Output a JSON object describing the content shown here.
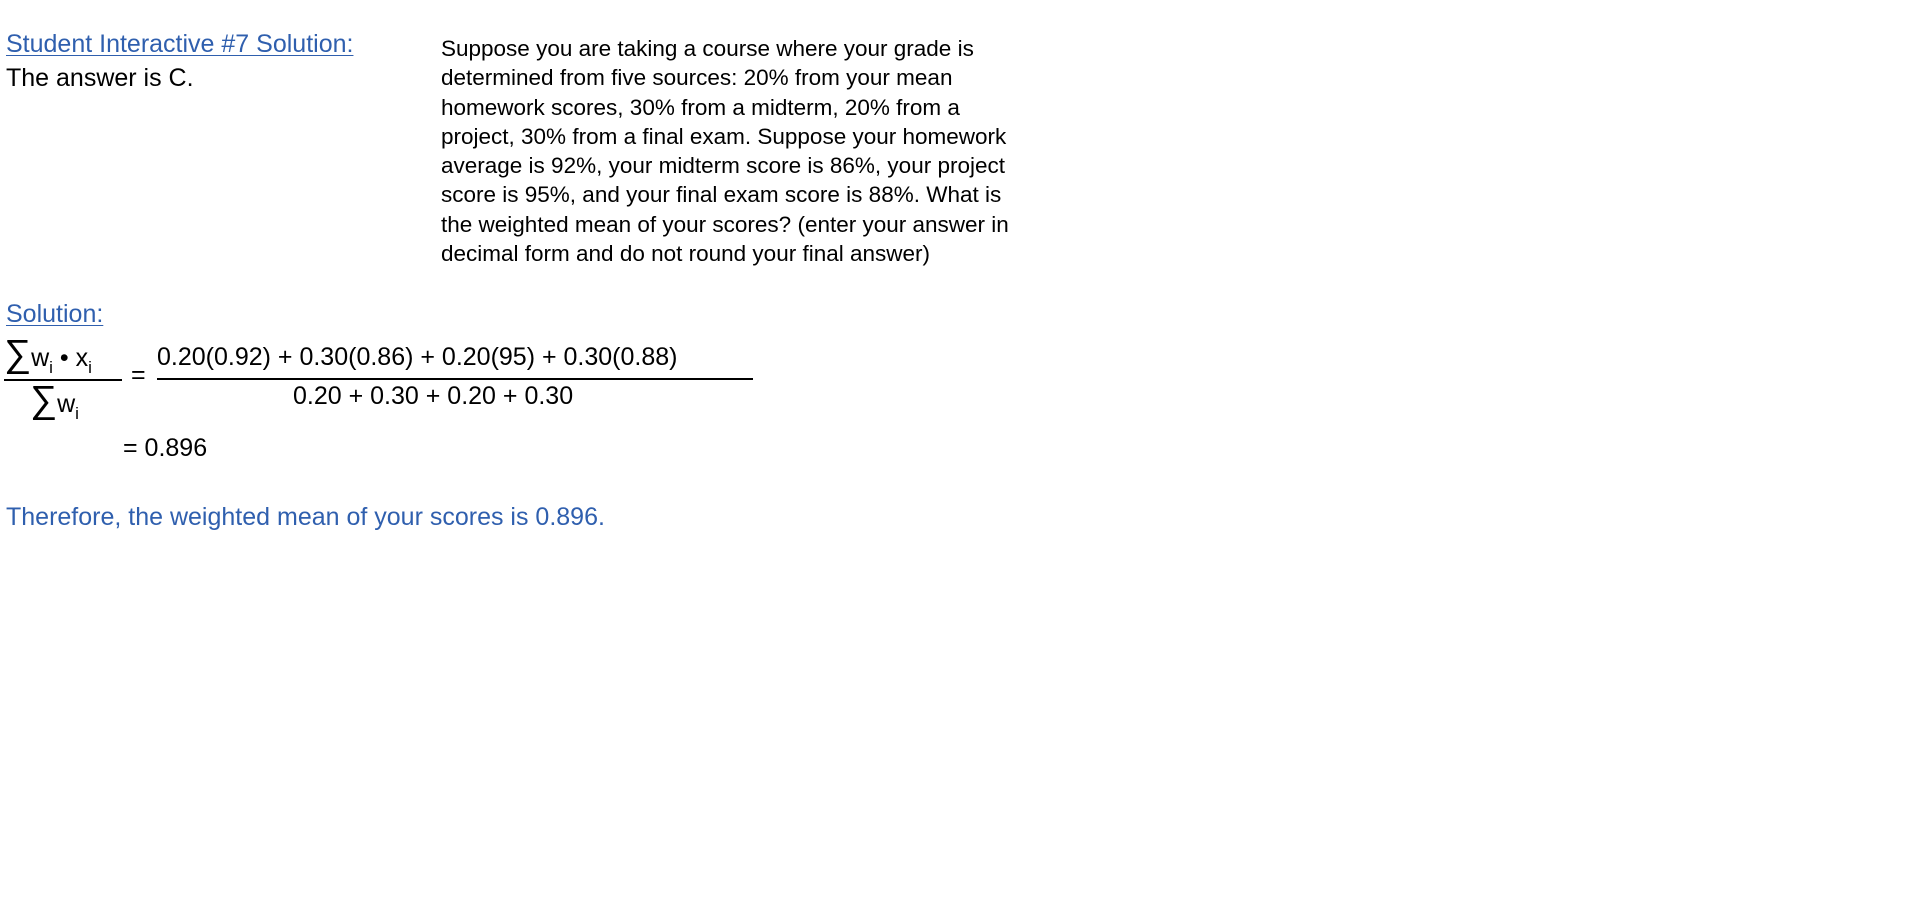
{
  "title": "Student Interactive #7 Solution:",
  "answer": "The answer is C.",
  "question_lines": [
    "Suppose you are taking a course where your grade is",
    "determined from five sources: 20% from your mean",
    "homework scores, 30% from a midterm, 20% from a",
    "project, 30% from a final exam.  Suppose your homework",
    "average is 92%, your midterm score is 86%, your project",
    "score is 95%, and your final exam score is 88%.  What is",
    "the weighted mean of your scores? (enter your answer in",
    "decimal form and do not round your final answer)"
  ],
  "solution_heading": "Solution:",
  "formula": {
    "sigma": "∑",
    "w": "w",
    "x": "x",
    "subscript": "i",
    "dot": " • ",
    "equals": "=",
    "numerator": "0.20(0.92) + 0.30(0.86) + 0.20(95) + 0.30(0.88)",
    "denominator": "0.20 + 0.30 + 0.20 + 0.30",
    "result": "= 0.896"
  },
  "conclusion": "Therefore, the weighted mean of your scores is 0.896.",
  "colors": {
    "heading_blue": "#2f5fae",
    "text": "#000000"
  }
}
